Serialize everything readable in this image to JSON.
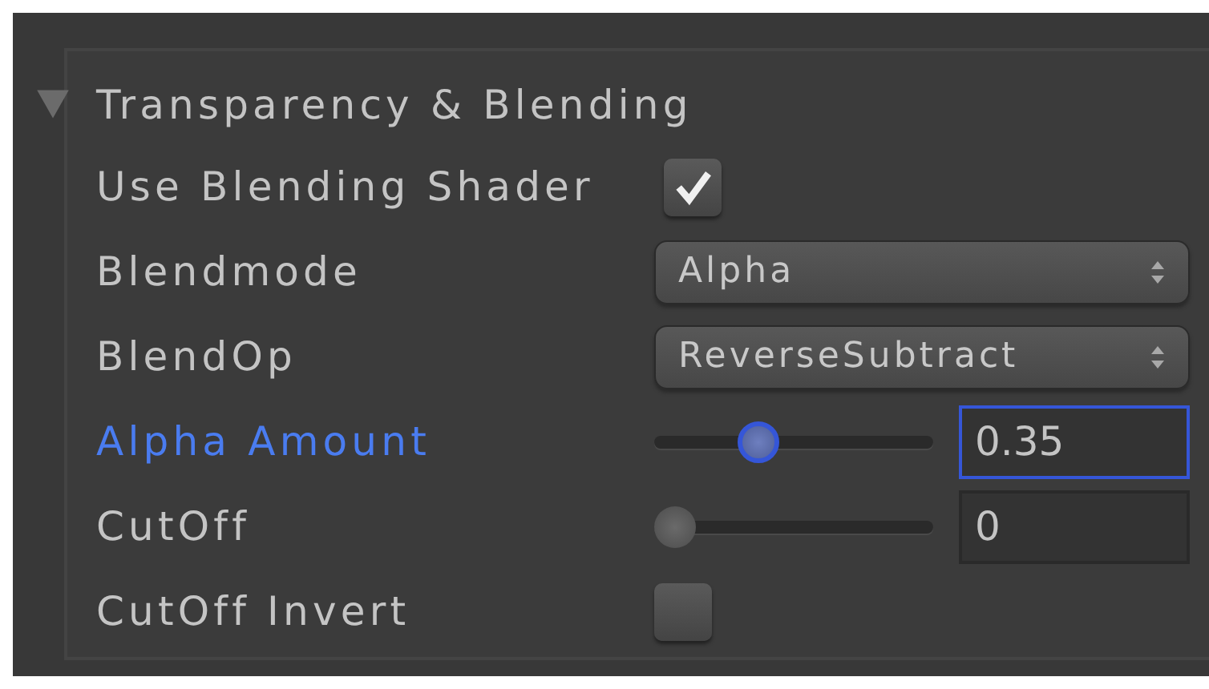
{
  "section": {
    "title": "Transparency & Blending",
    "expanded": true
  },
  "properties": [
    {
      "kind": "checkbox",
      "label": "Use Blending Shader",
      "checked": true
    },
    {
      "kind": "dropdown",
      "label": "Blendmode",
      "value": "Alpha"
    },
    {
      "kind": "dropdown",
      "label": "BlendOp",
      "value": "ReverseSubtract"
    },
    {
      "kind": "slider",
      "label": "Alpha Amount",
      "focused": true,
      "level": 0.35,
      "value": "0.35"
    },
    {
      "kind": "slider",
      "label": "CutOff",
      "focused": false,
      "level": 0,
      "value": "0"
    },
    {
      "kind": "checkbox",
      "label": "CutOff Invert",
      "checked": false
    }
  ]
}
